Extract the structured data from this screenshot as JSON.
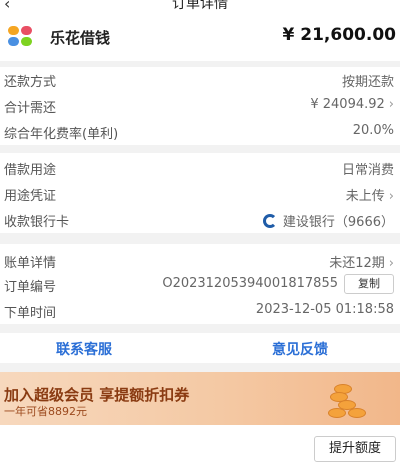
{
  "nav": {
    "back_icon": "back-icon",
    "title": "订单详情"
  },
  "header": {
    "brand": "乐花借钱",
    "amount": "¥ 21,600.00",
    "logo_colors": [
      "#f5a623",
      "#e94f64",
      "#4a90e2",
      "#7ed321"
    ]
  },
  "repay": {
    "method_label": "还款方式",
    "method_value": "按期还款",
    "total_label": "合计需还",
    "total_value": "¥ 24094.92",
    "rate_label": "综合年化费率(单利)",
    "rate_value": "20.0%"
  },
  "loan": {
    "purpose_label": "借款用途",
    "purpose_value": "日常消费",
    "proof_label": "用途凭证",
    "proof_value": "未上传",
    "bank_label": "收款银行卡",
    "bank_value": "建设银行（9666）"
  },
  "bill": {
    "detail_label": "账单详情",
    "detail_value": "未还12期",
    "order_label": "订单编号",
    "order_value": "O20231205394001817855",
    "copy_label": "复制",
    "time_label": "下单时间",
    "time_value": "2023-12-05 01:18:58"
  },
  "actions": {
    "service": "联系客服",
    "feedback": "意见反馈"
  },
  "banner": {
    "title": "加入超级会员  享提额折扣券",
    "subtitle": "一年可省8892元"
  },
  "footer": {
    "raise_button": "提升额度"
  },
  "colors": {
    "accent": "#2b6fd6",
    "bank": "#1f5ca8"
  }
}
